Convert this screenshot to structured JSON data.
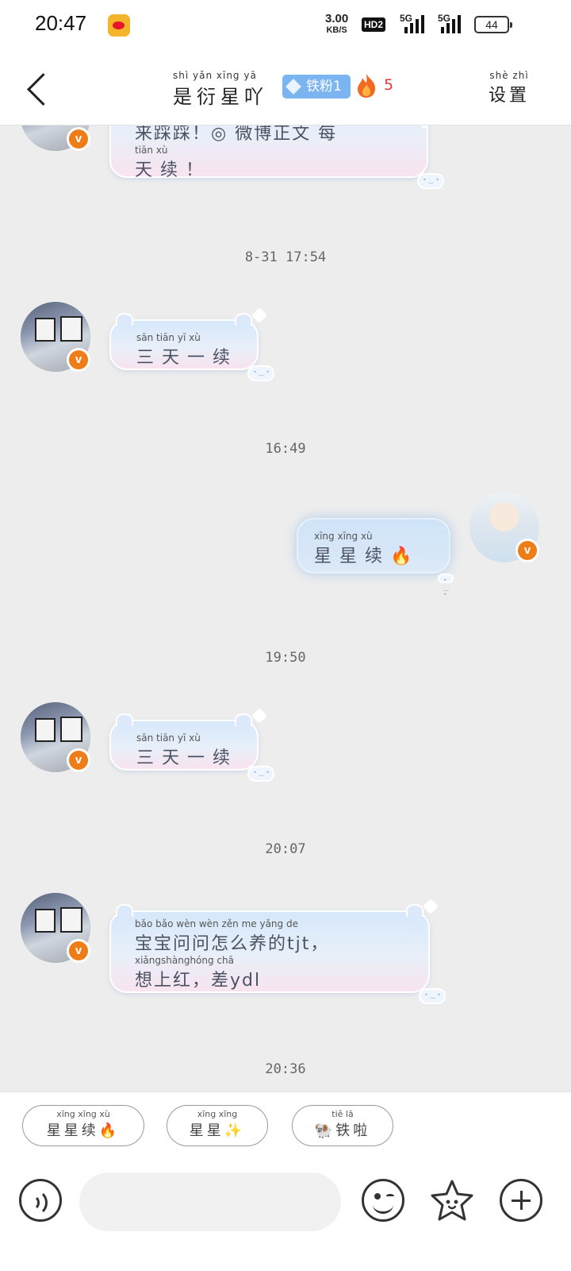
{
  "status_bar": {
    "time": "20:47",
    "app_icon": "weibo-icon",
    "net_speed": "3.00",
    "net_speed_unit": "KB/S",
    "hd_label": "HD2",
    "sim1_label": "5G",
    "sim2_label": "5G",
    "battery": "44"
  },
  "header": {
    "title_pinyin": "shì yǎn xīng yā",
    "title": "是衍星吖",
    "fan_badge": "铁粉1",
    "fire_count": "5",
    "settings_pinyin": "shè zhì",
    "settings": "设置"
  },
  "messages": [
    {
      "type": "partial_bubble",
      "line1_tx": "来踩踩！◎ 微博正文 每",
      "line2_py": "tiān xù",
      "line2_tx": "天续！"
    },
    {
      "type": "timestamp",
      "text": "8-31 17:54"
    },
    {
      "type": "incoming",
      "py": "sān tiān yī xù",
      "tx": "三天一续"
    },
    {
      "type": "timestamp",
      "text": "16:49"
    },
    {
      "type": "outgoing",
      "py": "xīng xīng xù",
      "tx": "星星续🔥"
    },
    {
      "type": "timestamp",
      "text": "19:50"
    },
    {
      "type": "incoming",
      "py": "sān tiān yī xù",
      "tx": "三天一续"
    },
    {
      "type": "timestamp",
      "text": "20:07"
    },
    {
      "type": "incoming",
      "py": "bǎo bǎo wèn wèn zěn me yǎng de",
      "tx": "宝宝问问怎么养的tjt，",
      "py2": "xiǎngshànghóng     chā",
      "tx2": "想上红，差ydl"
    },
    {
      "type": "timestamp",
      "text": "20:36"
    }
  ],
  "quick_replies": [
    {
      "py": "xīng xīng xù",
      "tx": "星星续🔥"
    },
    {
      "py": "xīng xīng",
      "tx": "星星✨"
    },
    {
      "py": "tiě lā",
      "tx": "🐏铁啦"
    }
  ],
  "input": {
    "placeholder": "",
    "voice_icon": "voice-icon",
    "emoji_icon": "emoji-icon",
    "sticker_icon": "star-sticker-icon",
    "plus_icon": "plus-icon"
  },
  "colors": {
    "accent_orange": "#ee7d18",
    "fan_badge_blue": "#7ab5f2",
    "fire_red": "#e4393c",
    "chat_bg": "#ededed"
  }
}
